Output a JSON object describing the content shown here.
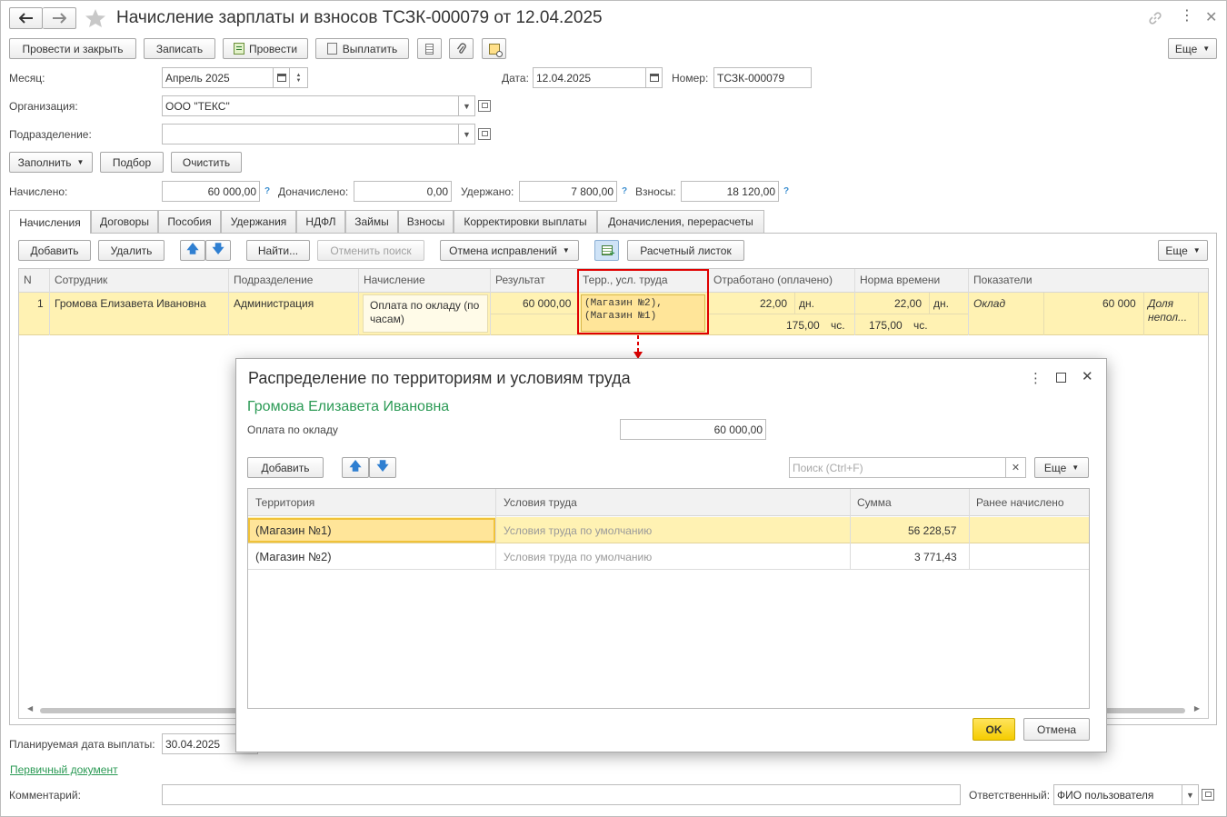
{
  "window": {
    "title": "Начисление зарплаты и взносов ТСЗК-000079 от 12.04.2025"
  },
  "toolbar": {
    "post_close": "Провести и закрыть",
    "save": "Записать",
    "post": "Провести",
    "pay": "Выплатить",
    "more": "Еще"
  },
  "form": {
    "month_label": "Месяц:",
    "month_value": "Апрель 2025",
    "date_label": "Дата:",
    "date_value": "12.04.2025",
    "number_label": "Номер:",
    "number_value": "ТСЗК-000079",
    "org_label": "Организация:",
    "org_value": "ООО \"ТЕКС\"",
    "dept_label": "Подразделение:",
    "dept_value": "",
    "fill_btn": "Заполнить",
    "select_btn": "Подбор",
    "clear_btn": "Очистить",
    "accrued_label": "Начислено:",
    "accrued_value": "60 000,00",
    "extra_label": "Доначислено:",
    "extra_value": "0,00",
    "withheld_label": "Удержано:",
    "withheld_value": "7 800,00",
    "contrib_label": "Взносы:",
    "contrib_value": "18 120,00",
    "help": "?"
  },
  "tabs": [
    "Начисления",
    "Договоры",
    "Пособия",
    "Удержания",
    "НДФЛ",
    "Займы",
    "Взносы",
    "Корректировки выплаты",
    "Доначисления, перерасчеты"
  ],
  "grid_toolbar": {
    "add": "Добавить",
    "delete": "Удалить",
    "find": "Найти...",
    "cancel_search": "Отменить поиск",
    "cancel_fix": "Отмена исправлений",
    "payslip": "Расчетный листок",
    "more": "Еще"
  },
  "grid": {
    "headers": {
      "n": "N",
      "employee": "Сотрудник",
      "dept": "Подразделение",
      "accrual": "Начисление",
      "result": "Результат",
      "terr": "Терр., усл. труда",
      "worked": "Отработано (оплачено)",
      "norm": "Норма времени",
      "indicators": "Показатели"
    },
    "row": {
      "n": "1",
      "employee": "Громова Елизавета Ивановна",
      "dept": "Администрация",
      "accrual_line1": "Оплата по окладу (по",
      "accrual_line2": "часам)",
      "result": "60 000,00",
      "terr_line1": "(Магазин №2),",
      "terr_line2": "(Магазин №1)",
      "worked_days": "22,00",
      "days_unit": "дн.",
      "worked_hours": "175,00",
      "hours_unit": "чс.",
      "norm_days": "22,00",
      "norm_hours": "175,00",
      "indicator_name": "Оклад",
      "indicator_value": "60 000",
      "share_line1": "Доля",
      "share_line2": "непол..."
    }
  },
  "footer": {
    "pay_date_label": "Планируемая дата выплаты:",
    "pay_date_value": "30.04.2025",
    "primary_doc": "Первичный документ",
    "comment_label": "Комментарий:",
    "comment_value": "",
    "responsible_label": "Ответственный:",
    "responsible_value": "ФИО пользователя"
  },
  "dialog": {
    "title": "Распределение по территориям и условиям труда",
    "employee": "Громова Елизавета Ивановна",
    "accrual_label": "Оплата по окладу",
    "accrual_value": "60 000,00",
    "add": "Добавить",
    "search_placeholder": "Поиск (Ctrl+F)",
    "more": "Еще",
    "headers": {
      "territory": "Территория",
      "conditions": "Условия труда",
      "sum": "Сумма",
      "prev": "Ранее начислено"
    },
    "rows": [
      {
        "territory": "(Магазин №1)",
        "conditions": "Условия труда по умолчанию",
        "sum": "56 228,57",
        "prev": ""
      },
      {
        "territory": "(Магазин №2)",
        "conditions": "Условия труда по умолчанию",
        "sum": "3 771,43",
        "prev": ""
      }
    ],
    "ok": "OK",
    "cancel": "Отмена"
  },
  "colors": {
    "accent_yellow": "#fff2b3",
    "selection": "#ffe599",
    "highlight_red": "#e00000",
    "link_green": "#2b9a55",
    "help_blue": "#3d8fd0"
  }
}
